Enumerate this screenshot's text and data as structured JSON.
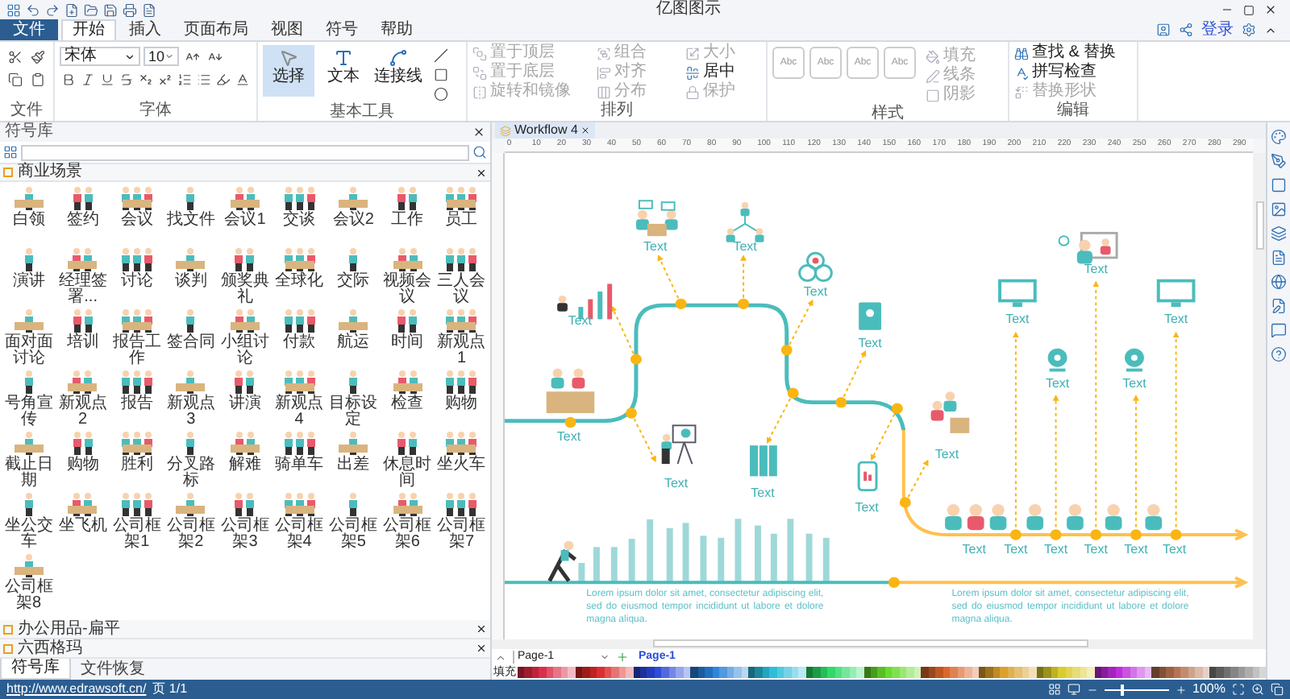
{
  "window": {
    "title": "亿图图示"
  },
  "menu_tabs": [
    {
      "label": "文件",
      "kind": "file",
      "selected": false
    },
    {
      "label": "开始",
      "kind": "tab",
      "selected": true
    },
    {
      "label": "插入",
      "kind": "tab",
      "selected": false
    },
    {
      "label": "页面布局",
      "kind": "tab",
      "selected": false
    },
    {
      "label": "视图",
      "kind": "tab",
      "selected": false
    },
    {
      "label": "符号",
      "kind": "tab",
      "selected": false
    },
    {
      "label": "帮助",
      "kind": "tab",
      "selected": false
    }
  ],
  "account": {
    "login": "登录"
  },
  "ribbon": {
    "file_group": {
      "label": "文件"
    },
    "font_group": {
      "label": "字体",
      "font": "宋体",
      "size": "10"
    },
    "tools_group": {
      "label": "基本工具",
      "tools": [
        {
          "label": "选择",
          "selected": true
        },
        {
          "label": "文本",
          "selected": false
        },
        {
          "label": "连接线",
          "selected": false
        }
      ]
    },
    "arrange_group": {
      "label": "排列",
      "items": [
        {
          "label": "置于顶层",
          "disabled": true
        },
        {
          "label": "置于底层",
          "disabled": true
        },
        {
          "label": "旋转和镜像",
          "disabled": true
        },
        {
          "label": "组合",
          "disabled": true
        },
        {
          "label": "对齐",
          "disabled": true
        },
        {
          "label": "分布",
          "disabled": true
        },
        {
          "label": "大小",
          "disabled": true
        },
        {
          "label": "居中",
          "disabled": false
        },
        {
          "label": "保护",
          "disabled": true
        }
      ]
    },
    "style_group": {
      "label": "样式",
      "styles": [
        "Abc",
        "Abc",
        "Abc",
        "Abc"
      ],
      "items": [
        {
          "label": "填充",
          "disabled": true
        },
        {
          "label": "线条",
          "disabled": true
        },
        {
          "label": "阴影",
          "disabled": true
        }
      ]
    },
    "edit_group": {
      "label": "编辑",
      "items": [
        {
          "label": "查找 & 替换",
          "disabled": false
        },
        {
          "label": "拼写检查",
          "disabled": false
        },
        {
          "label": "替换形状",
          "disabled": true
        }
      ]
    }
  },
  "library": {
    "title": "符号库",
    "category": "商业场景",
    "items": [
      "白领",
      "签约",
      "会议",
      "找文件",
      "会议1",
      "交谈",
      "会议2",
      "工作",
      "员工",
      "演讲",
      "经理签署...",
      "讨论",
      "谈判",
      "颁奖典礼",
      "全球化",
      "交际",
      "视频会议",
      "三人会议",
      "面对面讨论",
      "培训",
      "报告工作",
      "签合同",
      "小组讨论",
      "付款",
      "航运",
      "时间",
      "新观点1",
      "号角宣传",
      "新观点2",
      "报告",
      "新观点3",
      "讲演",
      "新观点4",
      "目标设定",
      "检查",
      "购物",
      "截止日期",
      "购物",
      "胜利",
      "分叉路标",
      "解难",
      "骑单车",
      "出差",
      "休息时间",
      "坐火车",
      "坐公交车",
      "坐飞机",
      "公司框架1",
      "公司框架2",
      "公司框架3",
      "公司框架4",
      "公司框架5",
      "公司框架6",
      "公司框架7",
      "公司框架8"
    ],
    "collapsed_categories": [
      "办公用品-扁平",
      "六西格玛"
    ],
    "tabs": [
      {
        "label": "符号库",
        "selected": true
      },
      {
        "label": "文件恢复",
        "selected": false
      }
    ]
  },
  "document_tab": {
    "title": "Workflow 4"
  },
  "ruler": {
    "labels": [
      "0",
      "10",
      "20",
      "30",
      "40",
      "50",
      "60",
      "70",
      "80",
      "90",
      "100",
      "110",
      "120",
      "130",
      "140",
      "150",
      "160",
      "170",
      "180",
      "190",
      "200",
      "210",
      "220",
      "230",
      "240",
      "250",
      "260",
      "270",
      "280",
      "290"
    ]
  },
  "canvas": {
    "labels": [
      "Text",
      "Text",
      "Text",
      "Text",
      "Text",
      "Text",
      "Text",
      "Text",
      "Text",
      "Text",
      "Text",
      "Text",
      "Text",
      "Text",
      "Text",
      "Text",
      "Text",
      "Text",
      "Text",
      "Text",
      "Text"
    ],
    "paragraphs": [
      "Lorem ipsum dolor sit amet, consectetur adipiscing elit, sed do eiusmod tempor incididunt ut labore et dolore magna aliqua.",
      "Lorem ipsum dolor sit amet, consectetur adipiscing elit, sed do eiusmod tempor incididunt ut labore et dolore magna aliqua."
    ]
  },
  "page_bar": {
    "page_select": "Page-1",
    "pages": [
      {
        "label": "Page-1",
        "selected": true
      }
    ]
  },
  "palette": {
    "label": "填充"
  },
  "status_bar": {
    "link": "http://www.edrawsoft.cn/",
    "page": "页 1/1",
    "zoom": "100%",
    "level": 0.25
  }
}
